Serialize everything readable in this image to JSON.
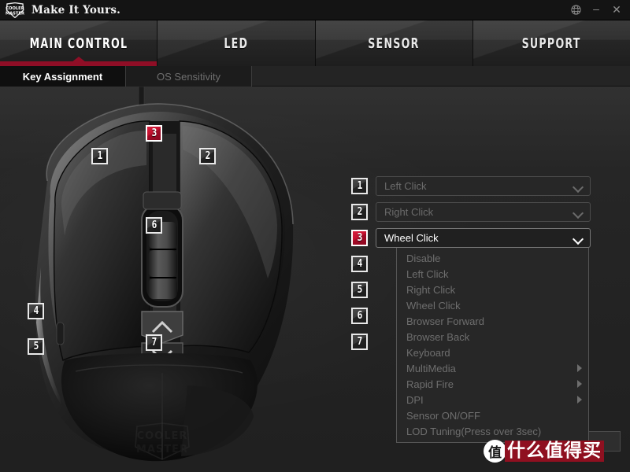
{
  "window": {
    "app_title": "Make It Yours.",
    "logo_text_top": "COOLER",
    "logo_text_bottom": "MASTER",
    "controls": {
      "globe": "⊕",
      "minimize": "–",
      "close": "✕"
    }
  },
  "main_tabs": [
    {
      "label": "MAIN CONTROL",
      "active": true
    },
    {
      "label": "LED",
      "active": false
    },
    {
      "label": "SENSOR",
      "active": false
    },
    {
      "label": "SUPPORT",
      "active": false
    }
  ],
  "sub_tabs": [
    {
      "label": "Key Assignment",
      "active": true
    },
    {
      "label": "OS Sensitivity",
      "active": false
    }
  ],
  "mouse_badges": [
    {
      "digit": "1",
      "active": false
    },
    {
      "digit": "2",
      "active": false
    },
    {
      "digit": "3",
      "active": true
    },
    {
      "digit": "4",
      "active": false
    },
    {
      "digit": "5",
      "active": false
    },
    {
      "digit": "6",
      "active": false
    },
    {
      "digit": "7",
      "active": false
    }
  ],
  "assignments": [
    {
      "badge": "1",
      "value": "Left Click",
      "active": false,
      "open": false
    },
    {
      "badge": "2",
      "value": "Right Click",
      "active": false,
      "open": false
    },
    {
      "badge": "3",
      "value": "Wheel Click",
      "active": true,
      "open": true
    },
    {
      "badge": "4",
      "value": "",
      "active": false,
      "open": false
    },
    {
      "badge": "5",
      "value": "",
      "active": false,
      "open": false
    },
    {
      "badge": "6",
      "value": "",
      "active": false,
      "open": false
    },
    {
      "badge": "7",
      "value": "",
      "active": false,
      "open": false
    }
  ],
  "dropdown_menu": {
    "owner_badge": "3",
    "items": [
      {
        "label": "Disable",
        "submenu": false
      },
      {
        "label": "Left Click",
        "submenu": false
      },
      {
        "label": "Right Click",
        "submenu": false
      },
      {
        "label": "Wheel Click",
        "submenu": false
      },
      {
        "label": "Browser Forward",
        "submenu": false
      },
      {
        "label": "Browser Back",
        "submenu": false
      },
      {
        "label": "Keyboard",
        "submenu": false
      },
      {
        "label": "MultiMedia",
        "submenu": true
      },
      {
        "label": "Rapid Fire",
        "submenu": true
      },
      {
        "label": "DPI",
        "submenu": true
      },
      {
        "label": "Sensor ON/OFF",
        "submenu": false
      },
      {
        "label": "LOD Tuning(Press over 3sec)",
        "submenu": false
      }
    ]
  },
  "watermark": {
    "mark": "值",
    "text": "什么值得买"
  },
  "colors": {
    "accent_red": "#8f0e26",
    "badge_red": "#c2102e",
    "panel_bg": "#232323",
    "titlebar_bg": "#141414",
    "text_muted": "#6e6e6e",
    "text_active": "#ffffff"
  }
}
